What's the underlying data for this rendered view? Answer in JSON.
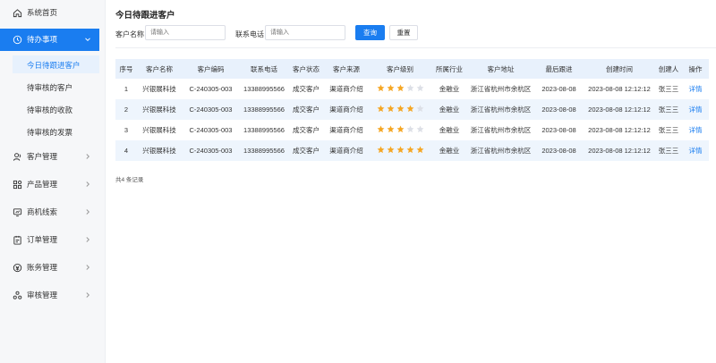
{
  "sidebar": {
    "home": "系统首页",
    "todo": "待办事项",
    "todo_sub": [
      "今日待跟进客户",
      "待审核的客户",
      "待审核的收款",
      "待审核的发票"
    ],
    "groups": [
      "客户管理",
      "产品管理",
      "商机线索",
      "订单管理",
      "账务管理",
      "审核管理"
    ]
  },
  "page": {
    "title": "今日待跟进客户"
  },
  "filters": {
    "name_label": "客户名称",
    "name_placeholder": "请输入",
    "phone_label": "联系电话",
    "phone_placeholder": "请输入",
    "search": "查询",
    "reset": "重置"
  },
  "table": {
    "headers": [
      "序号",
      "客户名称",
      "客户编码",
      "联系电话",
      "客户状态",
      "客户来源",
      "客户级别",
      "所属行业",
      "客户地址",
      "最后跟进",
      "创建时间",
      "创建人",
      "操作"
    ],
    "rows": [
      {
        "no": "1",
        "name": "兴银展科技",
        "code": "C-240305-003",
        "phone": "13388995566",
        "status": "成交客户",
        "source": "渠道商介绍",
        "level": 3,
        "industry": "金融业",
        "address": "浙江省杭州市余杭区",
        "last": "2023-08-08",
        "created": "2023-08-08 12:12:12",
        "creator": "张三三",
        "action": "详情"
      },
      {
        "no": "2",
        "name": "兴银展科技",
        "code": "C-240305-003",
        "phone": "13388995566",
        "status": "成交客户",
        "source": "渠道商介绍",
        "level": 4,
        "industry": "金融业",
        "address": "浙江省杭州市余杭区",
        "last": "2023-08-08",
        "created": "2023-08-08 12:12:12",
        "creator": "张三三",
        "action": "详情"
      },
      {
        "no": "3",
        "name": "兴银展科技",
        "code": "C-240305-003",
        "phone": "13388995566",
        "status": "成交客户",
        "source": "渠道商介绍",
        "level": 3,
        "industry": "金融业",
        "address": "浙江省杭州市余杭区",
        "last": "2023-08-08",
        "created": "2023-08-08 12:12:12",
        "creator": "张三三",
        "action": "详情"
      },
      {
        "no": "4",
        "name": "兴银展科技",
        "code": "C-240305-003",
        "phone": "13388995566",
        "status": "成交客户",
        "source": "渠道商介绍",
        "level": 5,
        "industry": "金融业",
        "address": "浙江省杭州市余杭区",
        "last": "2023-08-08",
        "created": "2023-08-08 12:12:12",
        "creator": "张三三",
        "action": "详情"
      }
    ],
    "max_stars": 5,
    "total": "共4 条记录"
  },
  "colors": {
    "accent": "#1a7df0",
    "star_on": "#f5a623",
    "star_off": "#dcdfe6",
    "header_bg": "#e8f1fc"
  }
}
